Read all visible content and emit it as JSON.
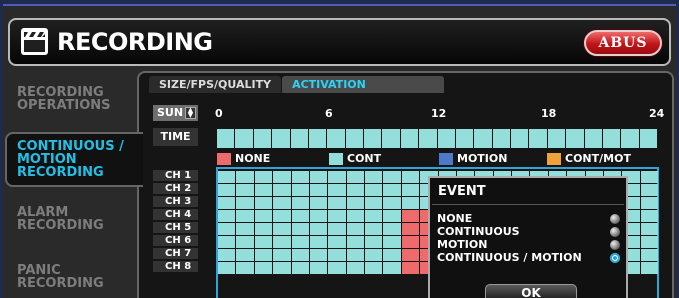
{
  "window": {
    "title": "RECORDING",
    "logo": "ABUS",
    "title_icon": "clapperboard-icon"
  },
  "sidebar": {
    "items": [
      {
        "label": "RECORDING OPERATIONS",
        "active": false
      },
      {
        "label": "CONTINUOUS / MOTION RECORDING",
        "active": true
      },
      {
        "label": "ALARM RECORDING",
        "active": false
      },
      {
        "label": "PANIC RECORDING",
        "active": false
      }
    ]
  },
  "tabs": [
    {
      "label": "SIZE/FPS/QUALITY",
      "active": false
    },
    {
      "label": "ACTIVATION",
      "active": true
    }
  ],
  "schedule": {
    "day": "SUN",
    "time_label": "TIME",
    "hours": [
      "0",
      "6",
      "12",
      "18",
      "24"
    ],
    "legend": [
      {
        "label": "NONE",
        "color": "#ef6b6b"
      },
      {
        "label": "CONT",
        "color": "#94dedb"
      },
      {
        "label": "MOTION",
        "color": "#4d79c8"
      },
      {
        "label": "CONT/MOT",
        "color": "#f0a23a"
      }
    ],
    "channels": [
      "CH 1",
      "CH 2",
      "CH 3",
      "CH 4",
      "CH 5",
      "CH 6",
      "CH 7",
      "CH 8"
    ],
    "colors": {
      "cont": "#94dedb",
      "none": "#ef6b6b",
      "grid_line": "#0d3e4a",
      "selection": "#2fa6d8"
    },
    "cells": {
      "default_mode": "CONT",
      "none_block": {
        "channels": [
          "CH 4",
          "CH 5",
          "CH 6",
          "CH 7",
          "CH 8"
        ],
        "hours_from": 10,
        "hours_to": 14
      }
    }
  },
  "event_popup": {
    "title": "EVENT",
    "options": [
      {
        "label": "NONE",
        "selected": false
      },
      {
        "label": "CONTINUOUS",
        "selected": false
      },
      {
        "label": "MOTION",
        "selected": false
      },
      {
        "label": "CONTINUOUS / MOTION",
        "selected": true
      }
    ],
    "ok_label": "OK"
  }
}
